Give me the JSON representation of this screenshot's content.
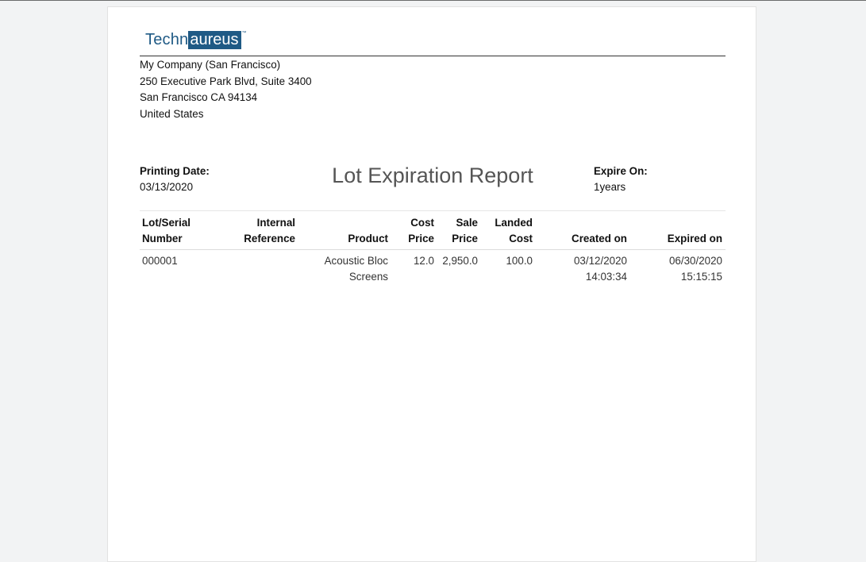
{
  "logo": {
    "text_a": "Techn",
    "text_b": "aureus",
    "tm": "™"
  },
  "company": {
    "name": "My Company (San Francisco)",
    "street": "250 Executive Park Blvd, Suite 3400",
    "city": "San Francisco CA 94134",
    "country": "United States"
  },
  "printing": {
    "label": "Printing Date:",
    "value": "03/13/2020"
  },
  "title": "Lot Expiration Report",
  "expire": {
    "label": "Expire On:",
    "value": "1years"
  },
  "table": {
    "headers": {
      "lot": [
        "Lot/Serial",
        "Number"
      ],
      "ref": [
        "Internal",
        "Reference"
      ],
      "product": "Product",
      "cost": [
        "Cost",
        "Price"
      ],
      "sale": [
        "Sale",
        "Price"
      ],
      "landed": [
        "Landed",
        "Cost"
      ],
      "created": "Created on",
      "expired": "Expired on"
    },
    "rows": [
      {
        "lot": "000001",
        "ref": "",
        "product": [
          "Acoustic Bloc",
          "Screens"
        ],
        "cost": "12.0",
        "sale": "2,950.0",
        "landed": "100.0",
        "created": [
          "03/12/2020",
          "14:03:34"
        ],
        "expired": [
          "06/30/2020",
          "15:15:15"
        ]
      }
    ]
  }
}
